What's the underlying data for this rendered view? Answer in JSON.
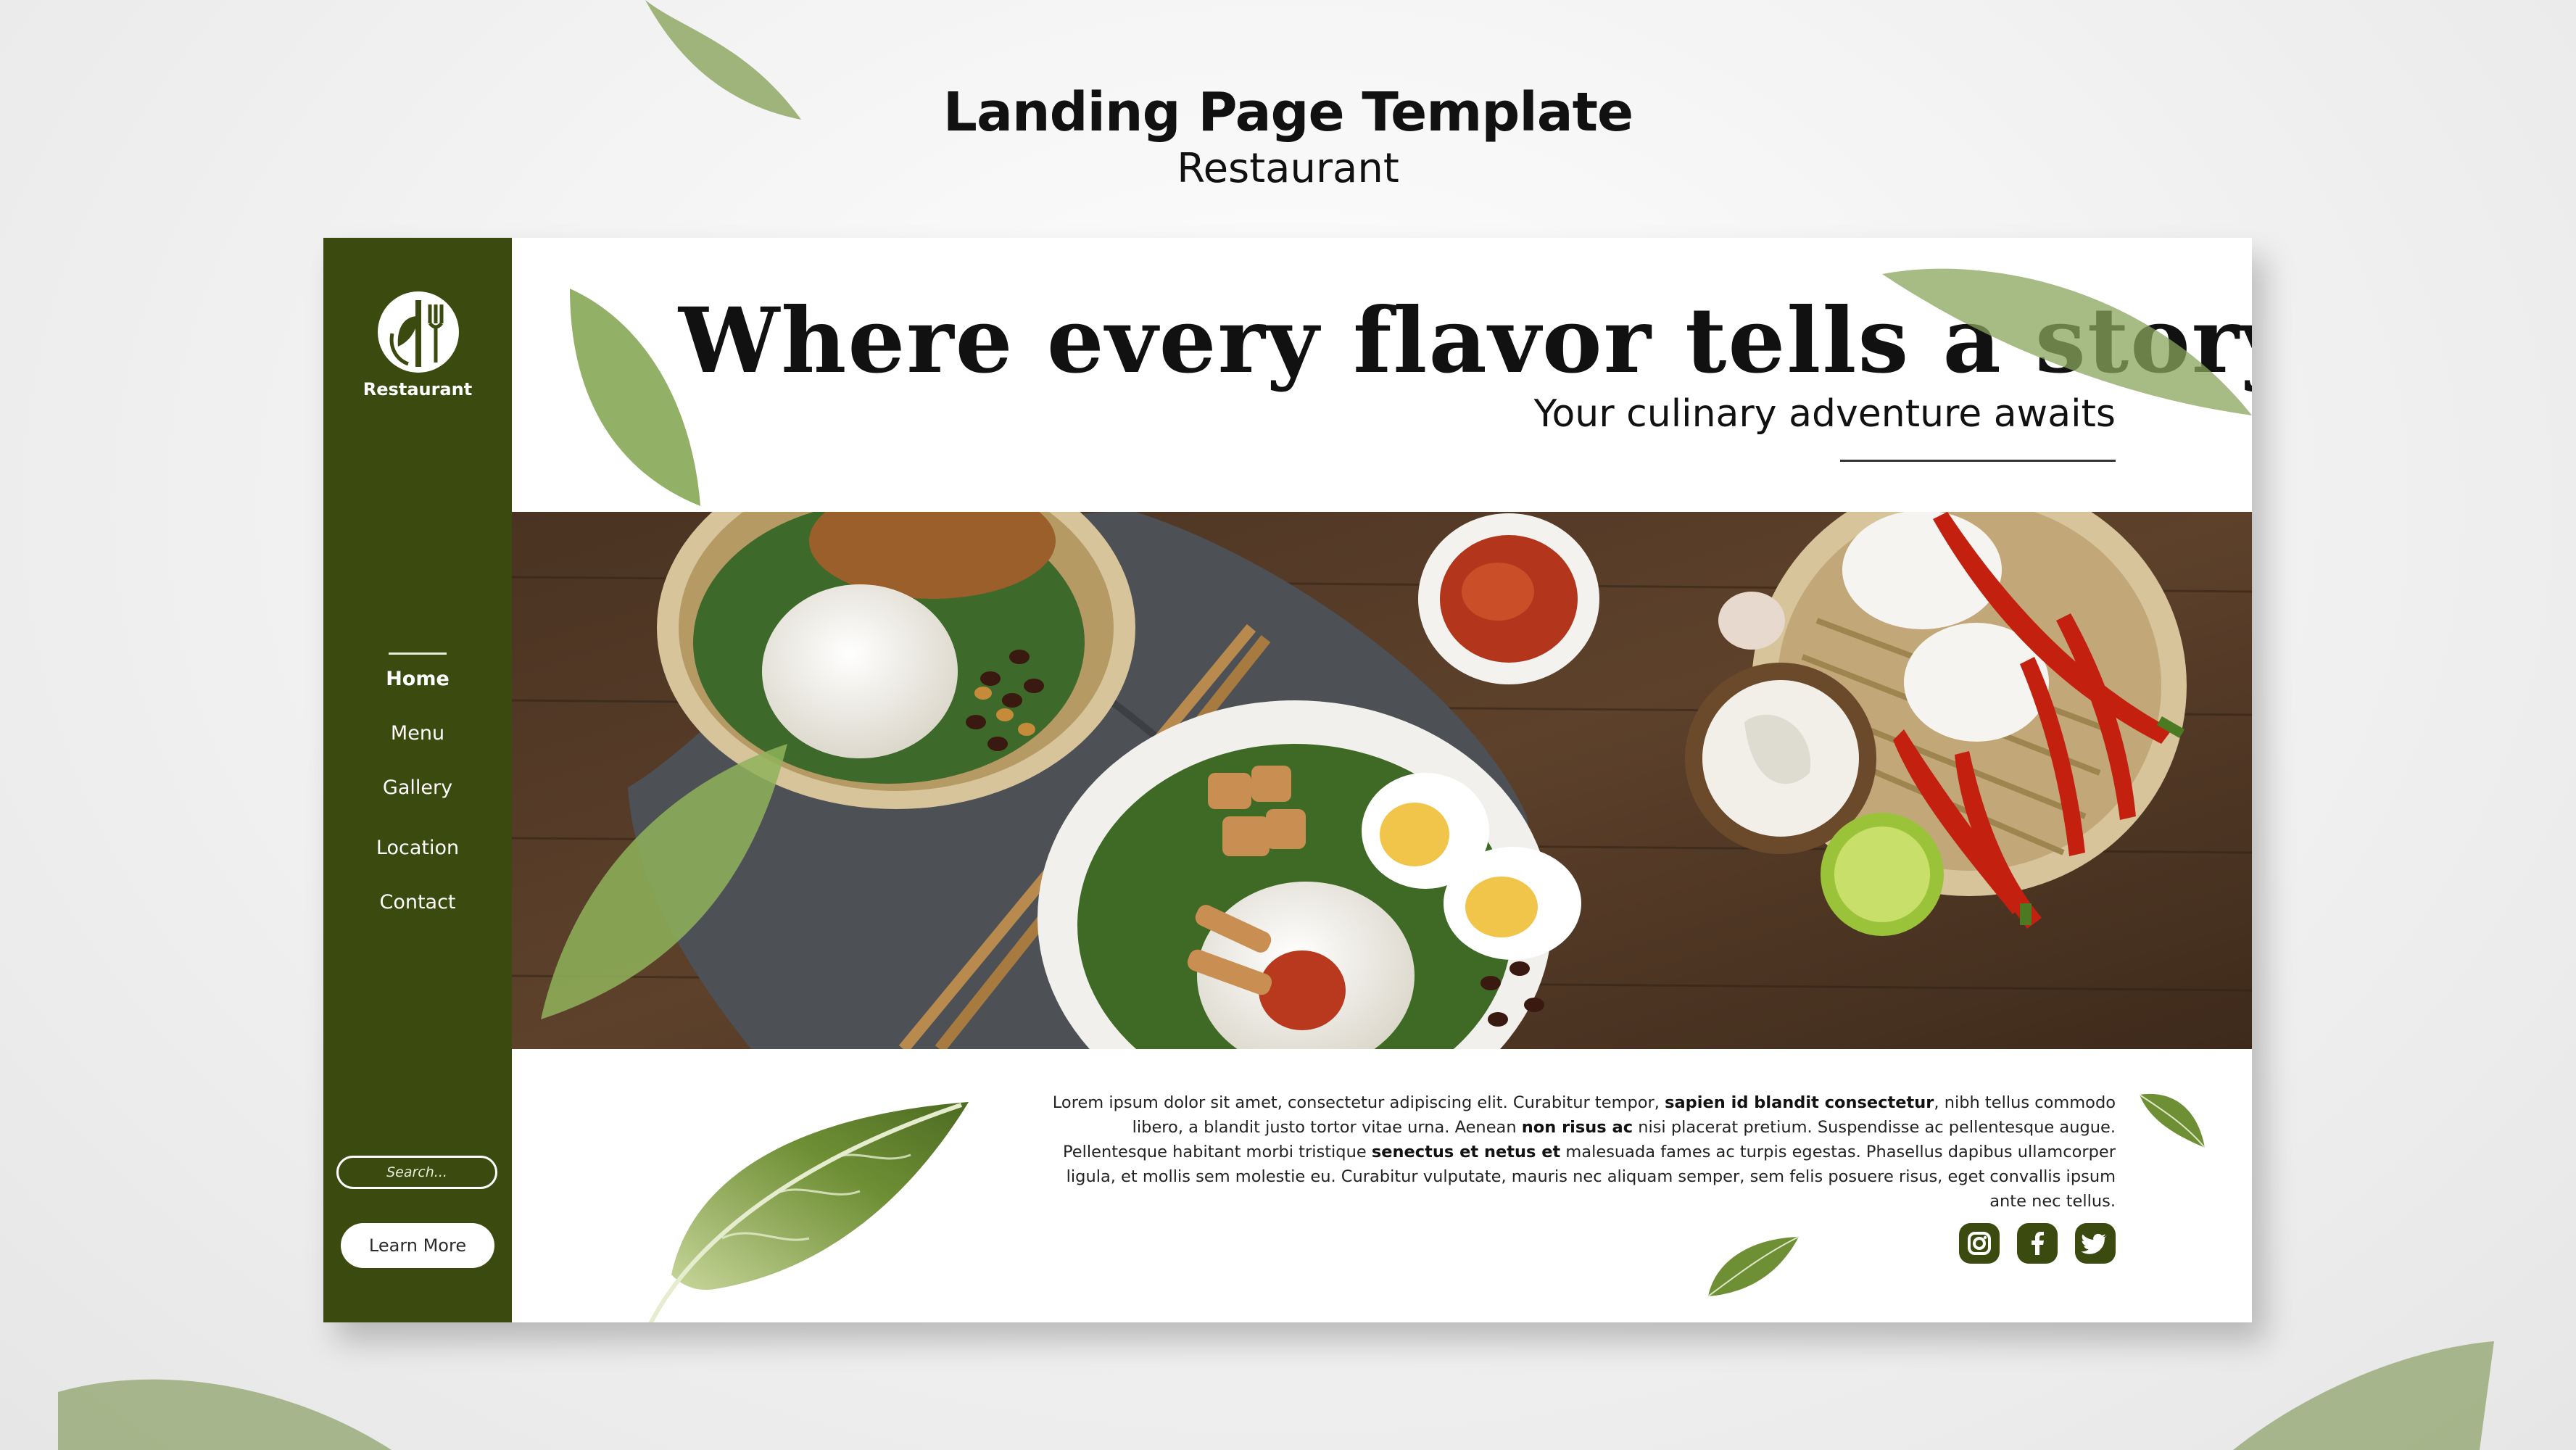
{
  "header": {
    "title": "Landing Page Template",
    "subtitle": "Restaurant"
  },
  "sidebar": {
    "logo_text": "Restaurant",
    "nav": [
      {
        "label": "Home"
      },
      {
        "label": "Menu"
      },
      {
        "label": "Gallery"
      },
      {
        "label": "Location"
      },
      {
        "label": "Contact"
      }
    ],
    "search_placeholder": "Search...",
    "cta_label": "Learn More"
  },
  "hero": {
    "headline": "Where every flavor tells a story",
    "tagline": "Your culinary adventure awaits"
  },
  "body": {
    "p1": "Lorem ipsum dolor sit amet, consectetur adipiscing elit. Curabitur tempor, ",
    "b1": "sapien id blandit consectetur",
    "p2": ", nibh tellus commodo libero, a blandit justo tortor vitae urna. Aenean ",
    "b2": "non risus ac",
    "p3": " nisi placerat pretium. Suspendisse ac pellentesque augue. Pellentesque habitant morbi tristique ",
    "b3": "senectus et netus et",
    "p4": " malesuada fames ac turpis egestas. Phasellus dapibus ullamcorper ligula, et mollis sem molestie eu. Curabitur vulputate, mauris nec aliquam semper, sem felis posuere risus, eget convallis ipsum ante nec tellus."
  },
  "social": [
    "instagram-icon",
    "facebook-icon",
    "twitter-icon"
  ],
  "colors": {
    "brand": "#3b4a0f",
    "background": "#ffffff",
    "leaf": "#7a9a4a"
  }
}
